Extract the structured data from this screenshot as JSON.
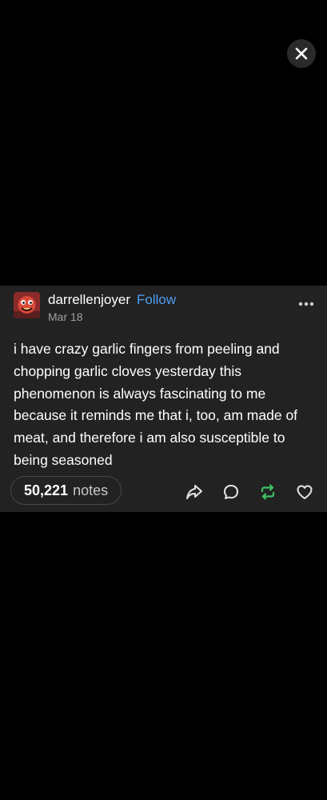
{
  "overlay": {
    "close_icon": "close-icon"
  },
  "post": {
    "avatar_icon": "avatar-image",
    "username": "darrellenjoyer",
    "follow_label": "Follow",
    "date": "Mar 18",
    "more_icon": "more-horizontal-icon",
    "body": "i have crazy garlic fingers from peeling and chopping garlic cloves yesterday this phenomenon is always fascinating to me because it reminds me that i, too, am made of meat, and therefore i am also susceptible to being seasoned",
    "notes_count": "50,221",
    "notes_label": "notes",
    "actions": {
      "share_icon": "share-icon",
      "reply_icon": "reply-icon",
      "reblog_icon": "reblog-icon",
      "like_icon": "heart-icon"
    }
  },
  "colors": {
    "background": "#000000",
    "card": "#222222",
    "accent_blue": "#4f9df5",
    "reblog_green": "#3ec364"
  }
}
